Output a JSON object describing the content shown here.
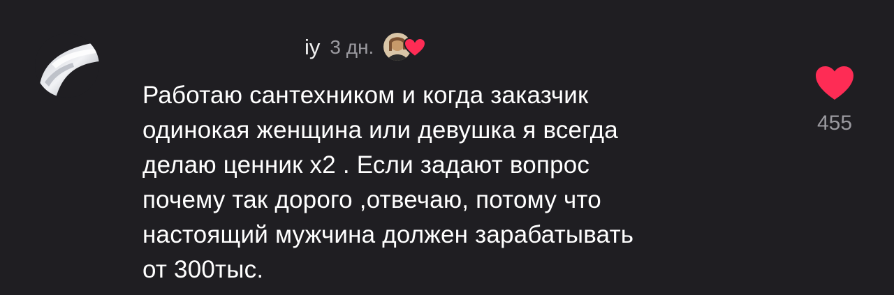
{
  "comment": {
    "username": "iy",
    "timestamp": "3 дн.",
    "text": "Работаю сантехником и когда заказчик\nодинокая женщина или девушка я всегда\nделаю ценник х2 . Если задают вопрос\nпочему так дорого ,отвечаю, потому что\nнастоящий мужчина должен зарабатывать\nот 300тыс.",
    "like_count": "455",
    "liked": true
  },
  "colors": {
    "background": "#1f1e22",
    "heart": "#fe2c55",
    "secondary_text": "#9b9aa0",
    "primary_text": "#ffffff"
  },
  "icons": {
    "like": "heart-icon",
    "creator_liked": "creator-liked-heart-icon"
  }
}
